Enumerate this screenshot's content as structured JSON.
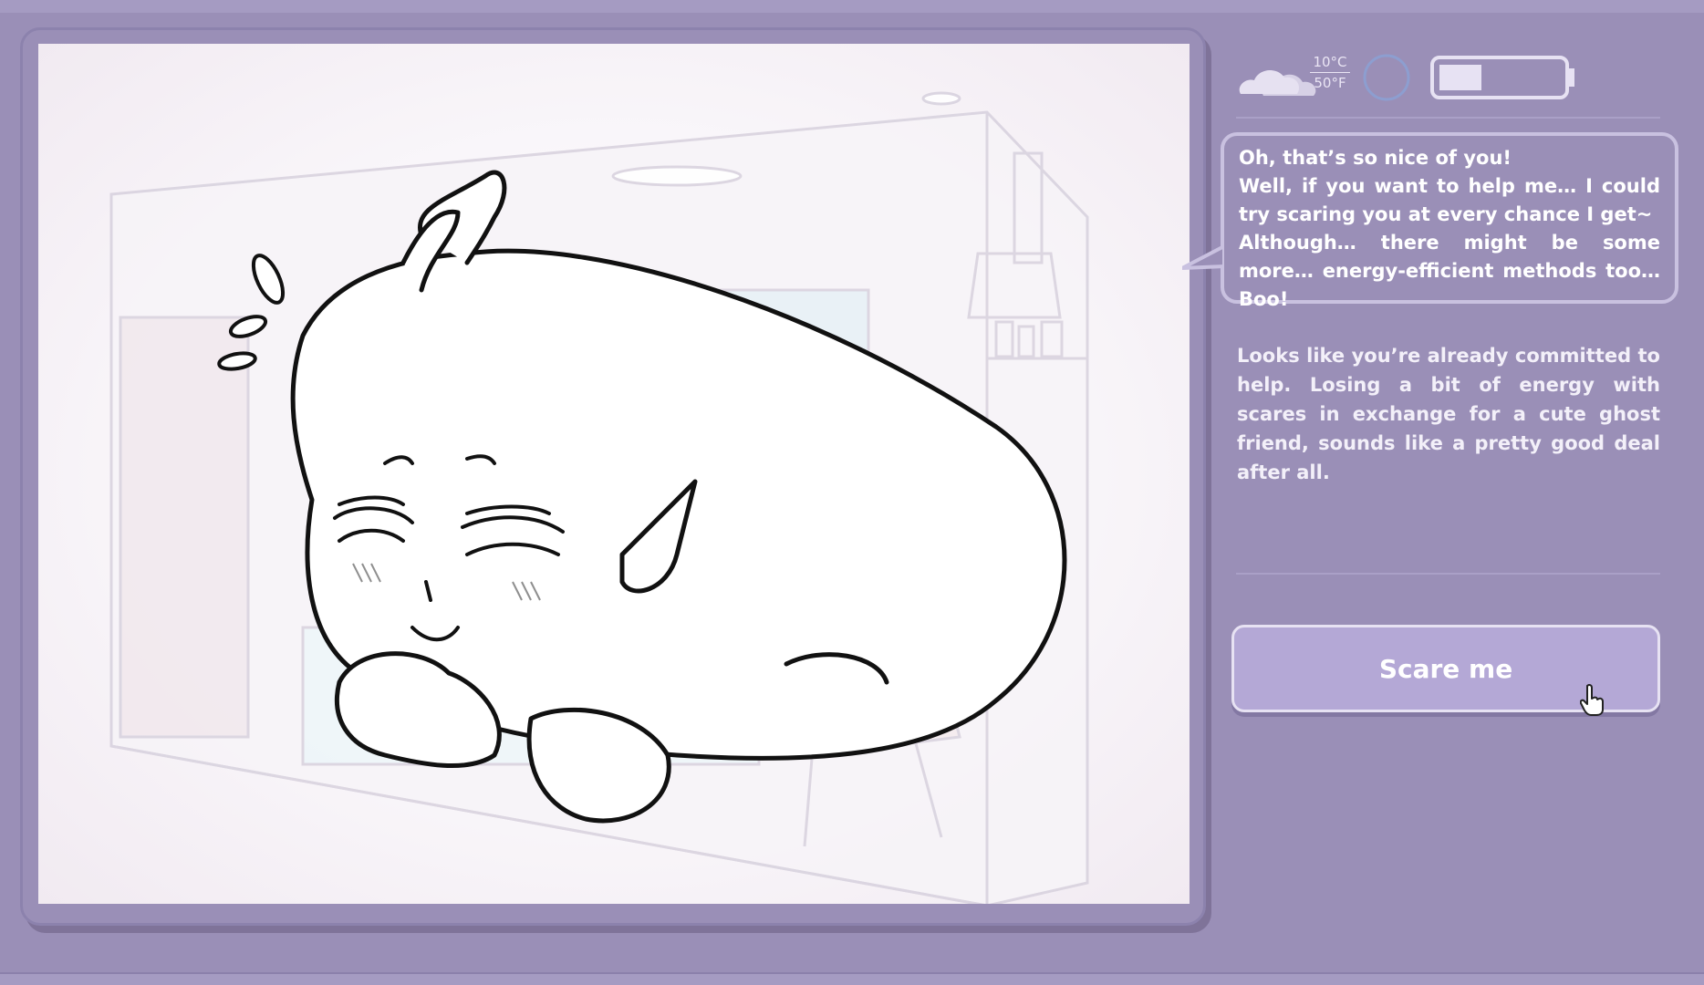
{
  "status": {
    "weather_icon": "cloudy-icon",
    "temp_c": "10°C",
    "temp_f": "50°F",
    "energy_level": 0.35
  },
  "dialogue": {
    "speech": "Oh, that’s so nice of you!\nWell, if you want to help me… I could try scaring you at every chance I get~\nAlthough… there might be some more… energy-efficient methods too… Boo!",
    "narration": "Looks like you’re already committed to help. Losing a bit of energy with scares in exchange for a cute ghost friend, sounds like a pretty good deal after all."
  },
  "actions": {
    "scare_label": "Scare me"
  },
  "colors": {
    "background": "#9a8fb7",
    "button": "#b4a8d6",
    "text": "#ffffff"
  }
}
